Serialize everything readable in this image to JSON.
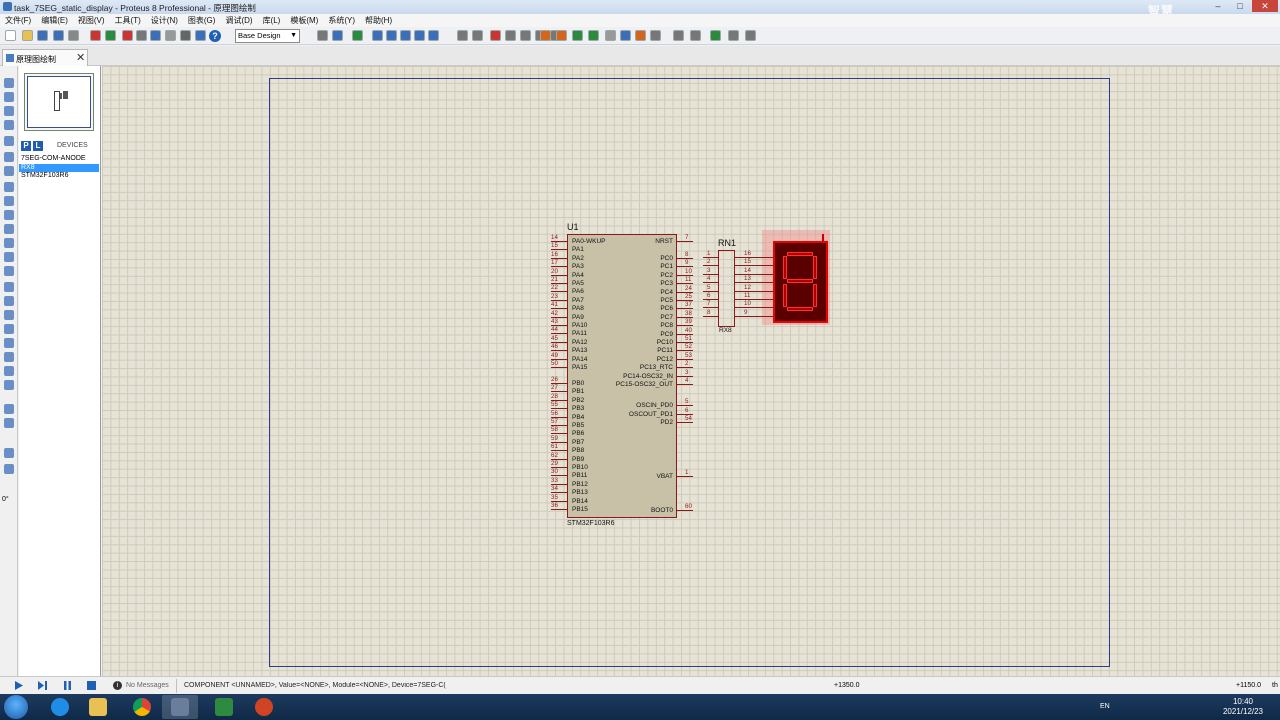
{
  "window": {
    "title": "task_7SEG_static_display - Proteus 8 Professional - 原理图绘制",
    "watermark": "智慧"
  },
  "menu": [
    "文件(F)",
    "编辑(E)",
    "视图(V)",
    "工具(T)",
    "设计(N)",
    "图表(G)",
    "调试(D)",
    "库(L)",
    "模板(M)",
    "系统(Y)",
    "帮助(H)"
  ],
  "toolbar": {
    "design_select": "Base Design",
    "help_icon": "?"
  },
  "tab": {
    "label": "原理图绘制",
    "close": "✕"
  },
  "sidepanel": {
    "p_btn": "P",
    "l_btn": "L",
    "devices_header": "DEVICES",
    "devices": [
      {
        "name": "7SEG-COM-ANODE",
        "selected": false
      },
      {
        "name": "RX8",
        "selected": true
      },
      {
        "name": "STM32F103R6",
        "selected": false
      }
    ]
  },
  "left_tools": {
    "rotation": "0°"
  },
  "schematic": {
    "u1_ref": "U1",
    "u1_part": "STM32F103R6",
    "left_pins": [
      {
        "num": "14",
        "name": "PA0-WKUP"
      },
      {
        "num": "15",
        "name": "PA1"
      },
      {
        "num": "16",
        "name": "PA2"
      },
      {
        "num": "17",
        "name": "PA3"
      },
      {
        "num": "20",
        "name": "PA4"
      },
      {
        "num": "21",
        "name": "PA5"
      },
      {
        "num": "22",
        "name": "PA6"
      },
      {
        "num": "23",
        "name": "PA7"
      },
      {
        "num": "41",
        "name": "PA8"
      },
      {
        "num": "42",
        "name": "PA9"
      },
      {
        "num": "43",
        "name": "PA10"
      },
      {
        "num": "44",
        "name": "PA11"
      },
      {
        "num": "45",
        "name": "PA12"
      },
      {
        "num": "46",
        "name": "PA13"
      },
      {
        "num": "49",
        "name": "PA14"
      },
      {
        "num": "50",
        "name": "PA15"
      },
      {
        "num": "26",
        "name": "PB0"
      },
      {
        "num": "27",
        "name": "PB1"
      },
      {
        "num": "28",
        "name": "PB2"
      },
      {
        "num": "55",
        "name": "PB3"
      },
      {
        "num": "56",
        "name": "PB4"
      },
      {
        "num": "57",
        "name": "PB5"
      },
      {
        "num": "58",
        "name": "PB6"
      },
      {
        "num": "59",
        "name": "PB7"
      },
      {
        "num": "61",
        "name": "PB8"
      },
      {
        "num": "62",
        "name": "PB9"
      },
      {
        "num": "29",
        "name": "PB10"
      },
      {
        "num": "30",
        "name": "PB11"
      },
      {
        "num": "33",
        "name": "PB12"
      },
      {
        "num": "34",
        "name": "PB13"
      },
      {
        "num": "35",
        "name": "PB14"
      },
      {
        "num": "36",
        "name": "PB15"
      }
    ],
    "right_pins": [
      {
        "num": "7",
        "name": "NRST"
      },
      {
        "num": "8",
        "name": "PC0"
      },
      {
        "num": "9",
        "name": "PC1"
      },
      {
        "num": "10",
        "name": "PC2"
      },
      {
        "num": "11",
        "name": "PC3"
      },
      {
        "num": "24",
        "name": "PC4"
      },
      {
        "num": "25",
        "name": "PC5"
      },
      {
        "num": "37",
        "name": "PC6"
      },
      {
        "num": "38",
        "name": "PC7"
      },
      {
        "num": "39",
        "name": "PC8"
      },
      {
        "num": "40",
        "name": "PC9"
      },
      {
        "num": "51",
        "name": "PC10"
      },
      {
        "num": "52",
        "name": "PC11"
      },
      {
        "num": "53",
        "name": "PC12"
      },
      {
        "num": "2",
        "name": "PC13_RTC"
      },
      {
        "num": "3",
        "name": "PC14-OSC32_IN"
      },
      {
        "num": "4",
        "name": "PC15-OSC32_OUT"
      },
      {
        "num": "5",
        "name": "OSCIN_PD0"
      },
      {
        "num": "6",
        "name": "OSCOUT_PD1"
      },
      {
        "num": "54",
        "name": "PD2"
      },
      {
        "num": "1",
        "name": "VBAT"
      },
      {
        "num": "60",
        "name": "BOOT0"
      }
    ],
    "rn1_ref": "RN1",
    "rn1_part": "RX8",
    "rn1_left_nums": [
      "1",
      "2",
      "3",
      "4",
      "5",
      "6",
      "7",
      "8"
    ],
    "rn1_right_nums": [
      "16",
      "15",
      "14",
      "13",
      "12",
      "11",
      "10",
      "9"
    ]
  },
  "status": {
    "messages": "No Messages",
    "info_icon": "i",
    "text": "COMPONENT <UNNAMED>, Value=<NONE>, Module=<NONE>, Device=7SEG-C(",
    "coord_x": "+1350.0",
    "coord_y": "+1150.0",
    "edge": "th"
  },
  "taskbar": {
    "time": "10:40",
    "date": "2021/12/23",
    "lang": "EN"
  }
}
